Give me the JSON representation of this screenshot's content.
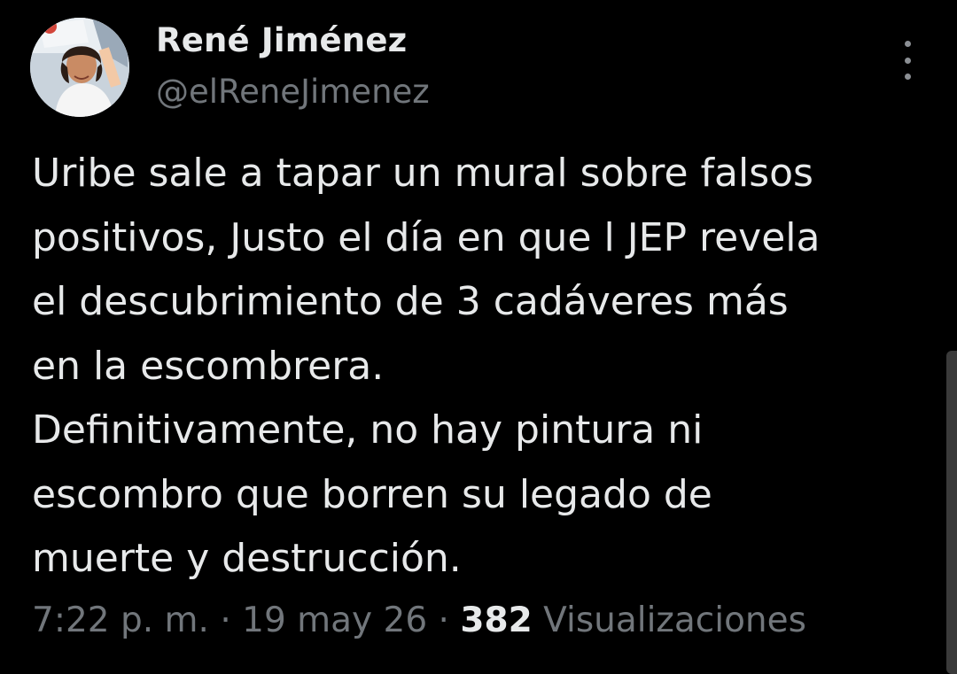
{
  "author": {
    "name": "René Jiménez",
    "handle": "@elReneJimenez"
  },
  "tweet": {
    "lines": [
      "Uribe sale a tapar un mural sobre falsos",
      "positivos, Justo el día en que l JEP revela",
      "el descubrimiento de 3 cadáveres más",
      "en la escombrera.",
      "Definitivamente, no hay pintura ni",
      "escombro que borren su legado de",
      "muerte y destrucción."
    ]
  },
  "meta": {
    "time": "7:22 p. m.",
    "separator": "·",
    "date": "19 may 26",
    "views_count": "382",
    "views_label": "Visualizaciones"
  },
  "icons": {
    "more": "more-vertical-icon"
  },
  "colors": {
    "background": "#000000",
    "primary_text": "#e7e9ea",
    "secondary_text": "#71767b"
  }
}
